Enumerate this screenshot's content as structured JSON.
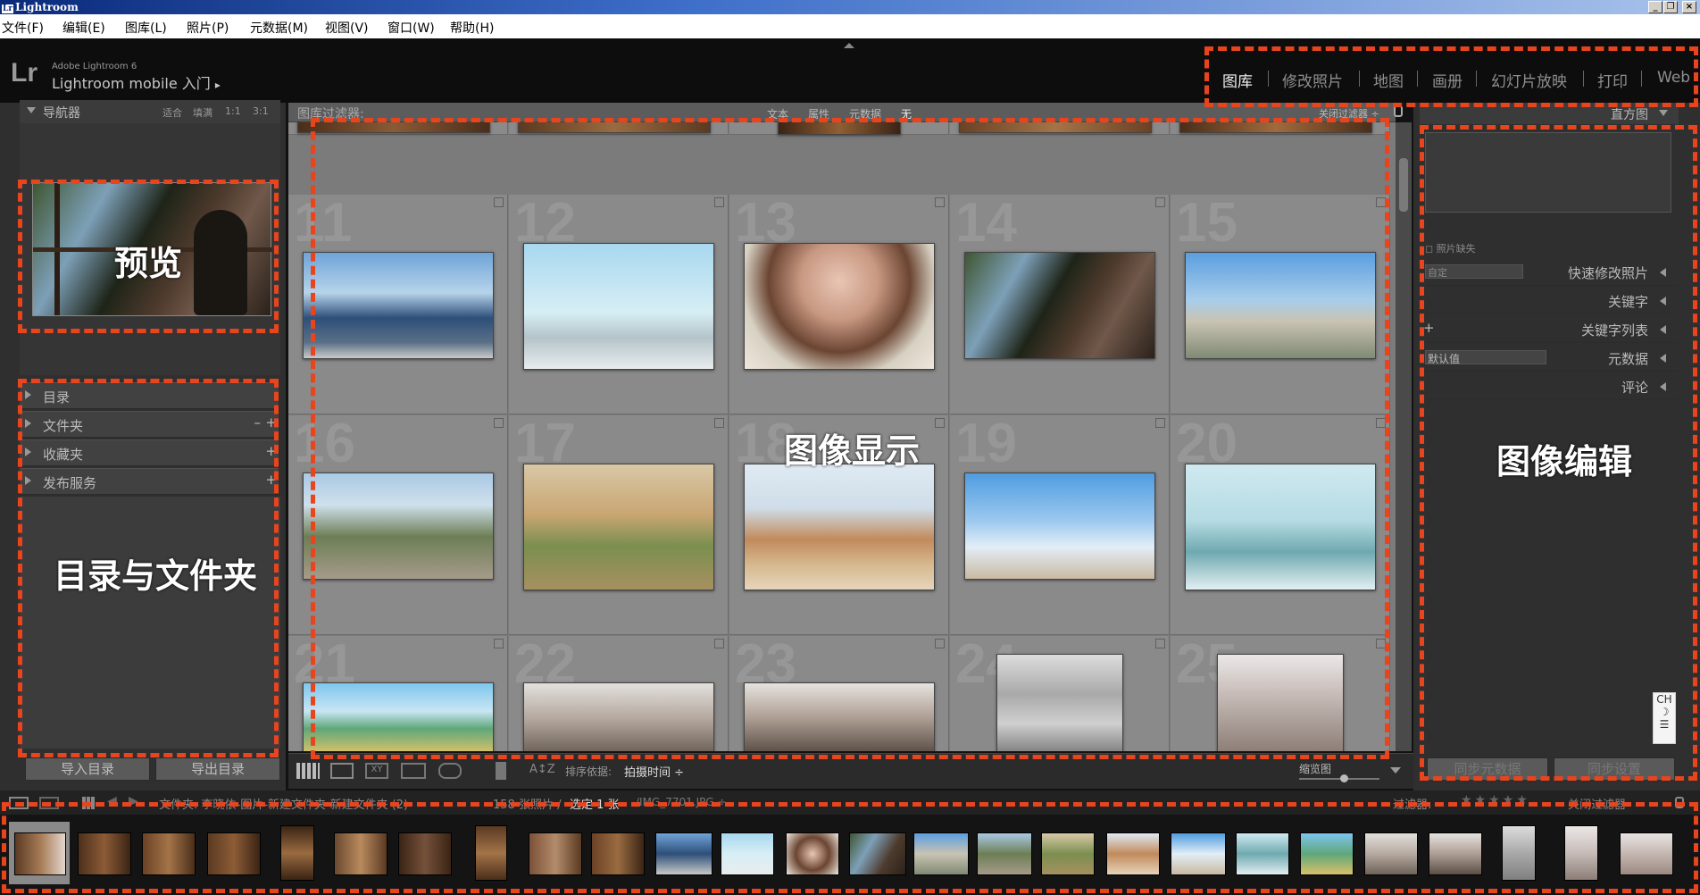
{
  "window": {
    "title": "Lightroom",
    "logo_mark": "Lr"
  },
  "menu": [
    "文件(F)",
    "编辑(E)",
    "图库(L)",
    "照片(P)",
    "元数据(M)",
    "视图(V)",
    "窗口(W)",
    "帮助(H)"
  ],
  "header": {
    "logo": "Lr",
    "brand": "Adobe Lightroom 6",
    "mobile": "Lightroom mobile 入门",
    "mobile_arrow": "▸"
  },
  "modules": [
    "图库",
    "修改照片",
    "地图",
    "画册",
    "幻灯片放映",
    "打印",
    "Web"
  ],
  "active_module": "图库",
  "left_panel": {
    "navigator": {
      "title": "导航器",
      "zoom": [
        "适合",
        "填满",
        "1:1",
        "3:1"
      ]
    },
    "sections": [
      "目录",
      "文件夹",
      "收藏夹",
      "发布服务"
    ],
    "import_button": "导入目录",
    "export_button": "导出目录"
  },
  "filter_bar": {
    "label": "图库过滤器:",
    "options": [
      "文本",
      "属性",
      "元数据",
      "无"
    ],
    "close": "关闭过滤器 ÷"
  },
  "grid": {
    "cells": [
      {
        "n": "11"
      },
      {
        "n": "12"
      },
      {
        "n": "13"
      },
      {
        "n": "14"
      },
      {
        "n": "15"
      },
      {
        "n": "16"
      },
      {
        "n": "17"
      },
      {
        "n": "18"
      },
      {
        "n": "19"
      },
      {
        "n": "20"
      },
      {
        "n": "21"
      },
      {
        "n": "22"
      },
      {
        "n": "23"
      },
      {
        "n": "24"
      },
      {
        "n": "25"
      }
    ]
  },
  "right_panel": {
    "histogram": "直方图",
    "missing": "照片缺失",
    "preset_select": "自定",
    "sections": [
      "快速修改照片",
      "关键字",
      "关键字列表",
      "元数据",
      "评论"
    ],
    "metadata_select": "默认值",
    "sync_meta": "同步元数据",
    "sync_settings": "同步设置"
  },
  "toolbar": {
    "sort_label": "排序依据:",
    "sort_value": "拍摄时间 ÷",
    "thumbs_label": "缩览图"
  },
  "filmstrip_bar": {
    "path": "文件夹: 李晓依-图片-新建文件夹-新建文件夹 (2)",
    "count": "158 张照片 /",
    "selected": "选定 1 张",
    "file": "/IMG_7701.JPG ÷",
    "filter": "过滤器:",
    "close_filter": "关闭过滤器"
  },
  "ime": [
    "CH",
    "☽",
    "☰"
  ],
  "annotations": {
    "preview": "预览",
    "catalog": "目录与文件夹",
    "display": "图像显示",
    "edit": "图像编辑"
  }
}
